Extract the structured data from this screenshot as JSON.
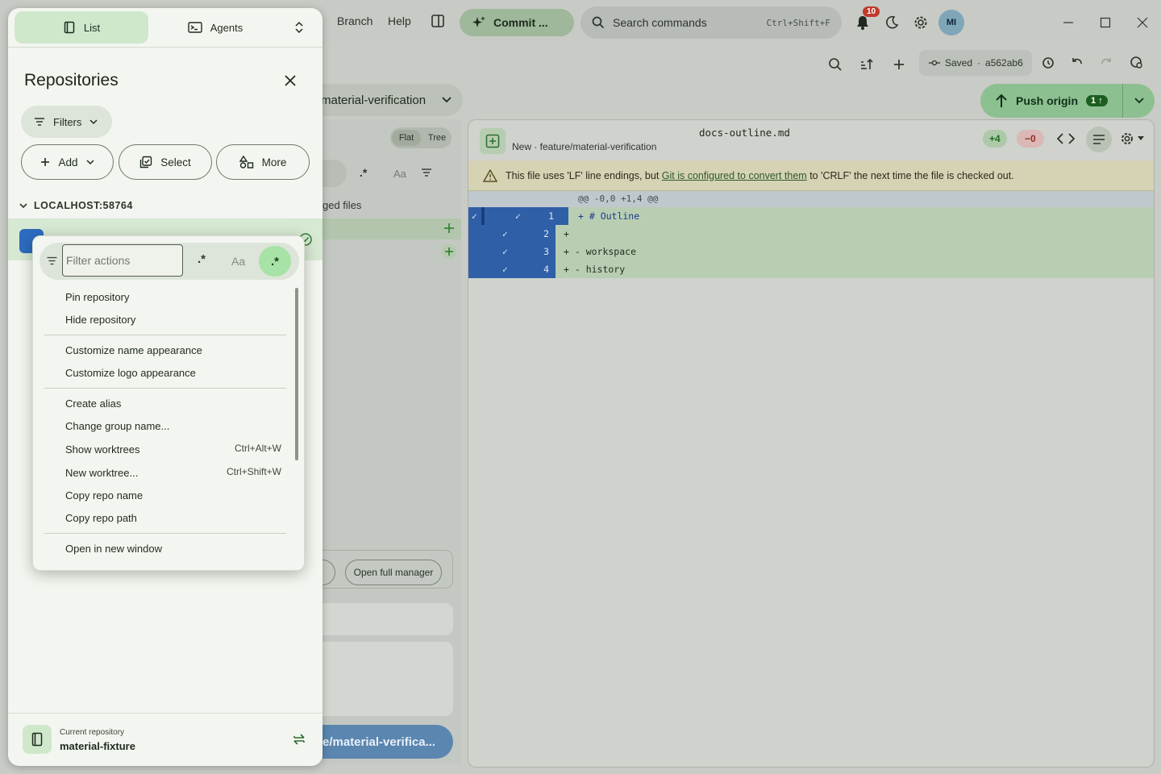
{
  "topbar": {
    "menu": [
      "Branch",
      "Help"
    ],
    "commit_label": "Commit ...",
    "search_placeholder": "Search commands",
    "search_shortcut": "Ctrl+Shift+F",
    "notifications_count": "10",
    "avatar_initials": "MI"
  },
  "toolbar": {
    "saved_label": "Saved",
    "commit_hash": "a562ab6"
  },
  "branch": {
    "name": "material-verification",
    "push_label": "Push origin",
    "push_count": "1"
  },
  "changes": {
    "view_flat": "Flat",
    "view_tree": "Tree",
    "header_fragment": "ged files",
    "open_full_manager": "Open full manager",
    "branch_button": "e/material-verifica..."
  },
  "diff": {
    "filename": "docs-outline.md",
    "subtitle": "New · feature/material-verification",
    "additions": "+4",
    "deletions": "−0",
    "warning_pre": "This file uses 'LF' line endings, but ",
    "warning_link": "Git is configured to convert them",
    "warning_post": " to 'CRLF' the next time the file is checked out.",
    "hunk": "@@ -0,0 +1,4 @@",
    "lines": [
      {
        "num": "1",
        "code": "+  # Outline"
      },
      {
        "num": "2",
        "code": "+"
      },
      {
        "num": "3",
        "code": "+  - workspace"
      },
      {
        "num": "4",
        "code": "+  - history"
      }
    ]
  },
  "drawer": {
    "tab_list": "List",
    "tab_agents": "Agents",
    "title": "Repositories",
    "filters": "Filters",
    "add": "Add",
    "select": "Select",
    "more": "More",
    "section": "LOCALHOST:58764",
    "footer_caption": "Current repository",
    "footer_repo": "material-fixture"
  },
  "context_menu": {
    "filter_placeholder": "Filter actions",
    "regex_label": ".*",
    "case_label": "Aa",
    "items": [
      {
        "label": "Pin repository",
        "shortcut": ""
      },
      {
        "label": "Hide repository",
        "shortcut": ""
      },
      {
        "label": "Customize name appearance",
        "shortcut": ""
      },
      {
        "label": "Customize logo appearance",
        "shortcut": ""
      },
      {
        "label": "Create alias",
        "shortcut": ""
      },
      {
        "label": "Change group name...",
        "shortcut": ""
      },
      {
        "label": "Show worktrees",
        "shortcut": "Ctrl+Alt+W"
      },
      {
        "label": "New worktree...",
        "shortcut": "Ctrl+Shift+W"
      },
      {
        "label": "Copy repo name",
        "shortcut": ""
      },
      {
        "label": "Copy repo path",
        "shortcut": ""
      },
      {
        "label": "Open in new window",
        "shortcut": ""
      }
    ]
  }
}
